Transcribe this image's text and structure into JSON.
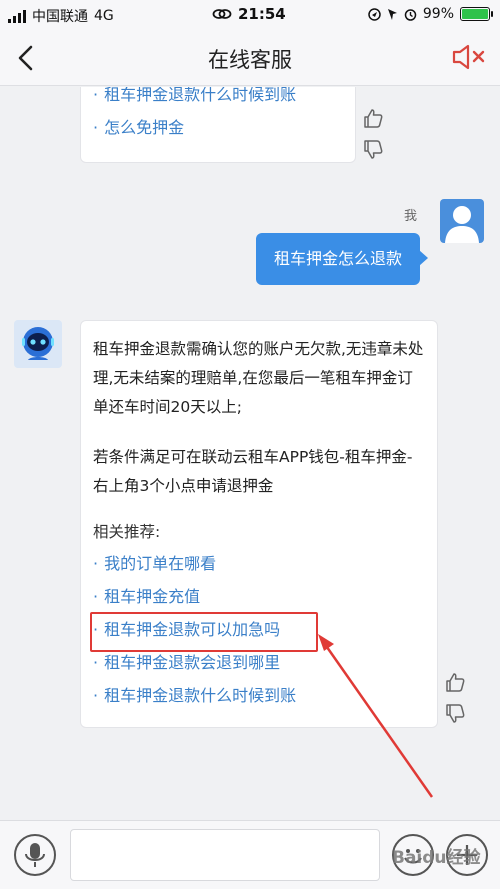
{
  "status_bar": {
    "carrier": "中国联通",
    "network": "4G",
    "time": "21:54",
    "battery": "99%",
    "battery_level": 0.99
  },
  "nav": {
    "title": "在线客服"
  },
  "prev_bot_message": {
    "links": [
      "租车押金退款什么时候到账",
      "怎么免押金"
    ]
  },
  "user_message": {
    "sender_label": "我",
    "text": "租车押金怎么退款"
  },
  "bot_message": {
    "paragraph1": "租车押金退款需确认您的账户无欠款,无违章未处理,无未结案的理赔单,在您最后一笔租车押金订单还车时间20天以上;",
    "paragraph2": "若条件满足可在联动云租车APP钱包-租车押金-右上角3个小点申请退押金",
    "recommend_title": "相关推荐:",
    "links": [
      "我的订单在哪看",
      "租车押金充值",
      "租车押金退款可以加急吗",
      "租车押金退款会退到哪里",
      "租车押金退款什么时候到账"
    ]
  },
  "bullet": "·",
  "watermark": "Baidu经验",
  "colors": {
    "accent": "#3a8ee6",
    "link": "#3a7fc8",
    "highlight": "#e03a36",
    "mute_icon": "#d9473f"
  }
}
